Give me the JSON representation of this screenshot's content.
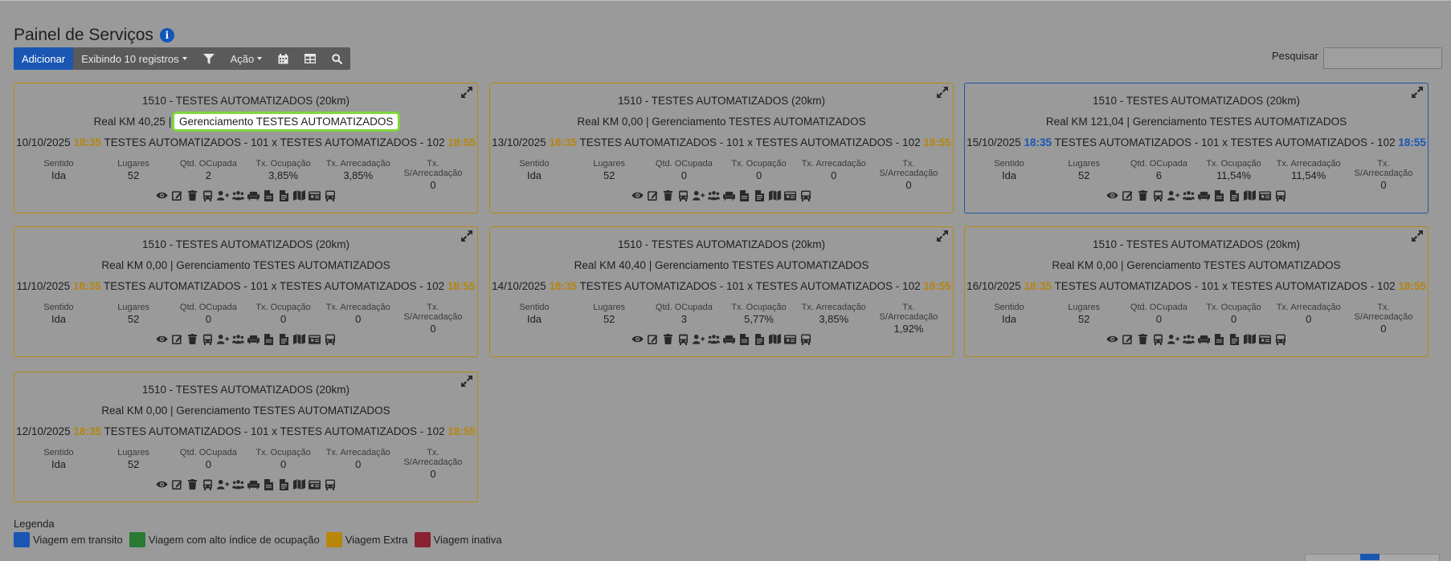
{
  "page": {
    "title": "Painel de Serviços"
  },
  "toolbar": {
    "add_label": "Adicionar",
    "records_label": "Exibindo 10 registros",
    "action_label": "Ação"
  },
  "search": {
    "label": "Pesquisar",
    "value": ""
  },
  "stat_labels": [
    "Sentido",
    "Lugares",
    "Qtd. OCupada",
    "Tx. Ocupação",
    "Tx. Arrecadação",
    "Tx. S/Arrecadação"
  ],
  "cards": [
    {
      "title": "1510 - TESTES AUTOMATIZADOS (20km)",
      "km": "Real KM 40,25",
      "sep": "|",
      "management": "Gerenciamento TESTES AUTOMATIZADOS",
      "date": "10/10/2025",
      "dep": "18:35",
      "route": "TESTES AUTOMATIZADOS - 101 x TESTES AUTOMATIZADOS - 102",
      "arr": "18:55",
      "status": "extra",
      "stats": [
        "Ida",
        "52",
        "2",
        "3,85%",
        "3,85%",
        "0"
      ]
    },
    {
      "title": "1510 - TESTES AUTOMATIZADOS (20km)",
      "km": "Real KM 0,00",
      "sep": "|",
      "management": "Gerenciamento TESTES AUTOMATIZADOS",
      "date": "13/10/2025",
      "dep": "18:35",
      "route": "TESTES AUTOMATIZADOS - 101 x TESTES AUTOMATIZADOS - 102",
      "arr": "18:55",
      "status": "extra",
      "stats": [
        "Ida",
        "52",
        "0",
        "0",
        "0",
        "0"
      ]
    },
    {
      "title": "1510 - TESTES AUTOMATIZADOS (20km)",
      "km": "Real KM 121,04",
      "sep": "|",
      "management": "Gerenciamento TESTES AUTOMATIZADOS",
      "date": "15/10/2025",
      "dep": "18:35",
      "route": "TESTES AUTOMATIZADOS - 101 x TESTES AUTOMATIZADOS - 102",
      "arr": "18:55",
      "status": "transit",
      "stats": [
        "Ida",
        "52",
        "6",
        "11,54%",
        "11,54%",
        "0"
      ]
    },
    {
      "title": "1510 - TESTES AUTOMATIZADOS (20km)",
      "km": "Real KM 0,00",
      "sep": "|",
      "management": "Gerenciamento TESTES AUTOMATIZADOS",
      "date": "11/10/2025",
      "dep": "18:35",
      "route": "TESTES AUTOMATIZADOS - 101 x TESTES AUTOMATIZADOS - 102",
      "arr": "18:55",
      "status": "extra",
      "stats": [
        "Ida",
        "52",
        "0",
        "0",
        "0",
        "0"
      ]
    },
    {
      "title": "1510 - TESTES AUTOMATIZADOS (20km)",
      "km": "Real KM 40,40",
      "sep": "|",
      "management": "Gerenciamento TESTES AUTOMATIZADOS",
      "date": "14/10/2025",
      "dep": "18:35",
      "route": "TESTES AUTOMATIZADOS - 101 x TESTES AUTOMATIZADOS - 102",
      "arr": "18:55",
      "status": "extra",
      "stats": [
        "Ida",
        "52",
        "3",
        "5,77%",
        "3,85%",
        "1,92%"
      ]
    },
    {
      "title": "1510 - TESTES AUTOMATIZADOS (20km)",
      "km": "Real KM 0,00",
      "sep": "|",
      "management": "Gerenciamento TESTES AUTOMATIZADOS",
      "date": "16/10/2025",
      "dep": "18:35",
      "route": "TESTES AUTOMATIZADOS - 101 x TESTES AUTOMATIZADOS - 102",
      "arr": "18:55",
      "status": "extra",
      "stats": [
        "Ida",
        "52",
        "0",
        "0",
        "0",
        "0"
      ]
    },
    {
      "title": "1510 - TESTES AUTOMATIZADOS (20km)",
      "km": "Real KM 0,00",
      "sep": "|",
      "management": "Gerenciamento TESTES AUTOMATIZADOS",
      "date": "12/10/2025",
      "dep": "18:35",
      "route": "TESTES AUTOMATIZADOS - 101 x TESTES AUTOMATIZADOS - 102",
      "arr": "18:55",
      "status": "extra",
      "stats": [
        "Ida",
        "52",
        "0",
        "0",
        "0",
        "0"
      ]
    }
  ],
  "card_icons": [
    "view-icon",
    "edit-icon",
    "delete-icon",
    "bus-front-icon",
    "add-passenger-icon",
    "passengers-icon",
    "seats-icon",
    "document-icon",
    "document-alt-icon",
    "map-icon",
    "id-card-icon",
    "bus-icon"
  ],
  "legend": {
    "title": "Legenda",
    "items": [
      {
        "label": "Viagem em transito",
        "color": "#1a57b3"
      },
      {
        "label": "Viagem com alto índice de ocupação",
        "color": "#2a7a33"
      },
      {
        "label": "Viagem Extra",
        "color": "#b8860b"
      },
      {
        "label": "Viagem inativa",
        "color": "#8a2230"
      }
    ]
  },
  "colors": {
    "accent": "#1a57b3",
    "extra": "#b5850f",
    "highlight_outline": "#7fd63a"
  }
}
